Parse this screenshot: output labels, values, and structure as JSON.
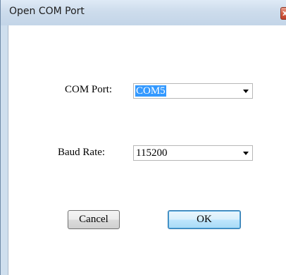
{
  "window": {
    "title": "Open COM Port",
    "close_glyph": "x"
  },
  "form": {
    "com_port": {
      "label": "COM Port:",
      "value": "COM5"
    },
    "baud_rate": {
      "label": "Baud Rate:",
      "value": "115200"
    }
  },
  "buttons": {
    "cancel_label": "Cancel",
    "ok_label": "OK"
  },
  "colors": {
    "selection": "#3399ff",
    "ok_border": "#3c7fb1"
  }
}
